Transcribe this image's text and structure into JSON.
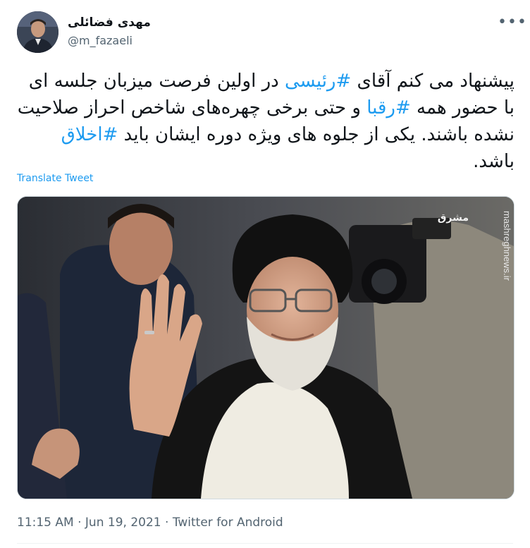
{
  "author": {
    "display_name": "مهدی فضائلی",
    "handle": "@m_fazaeli"
  },
  "more_icon": "more-horizontal-icon",
  "tweet": {
    "segments": [
      {
        "text": "پیشنهاد می کنم آقای ",
        "hashtag": false
      },
      {
        "text": "#رئیسی",
        "hashtag": true
      },
      {
        "text": " در اولین فرصت میزبان جلسه ای با حضور همه ",
        "hashtag": false
      },
      {
        "text": "#رقبا",
        "hashtag": true
      },
      {
        "text": " و حتی برخی چهره‌های شاخص احراز صلاحیت نشده باشند. یکی از جلوه های ویژه دوره ایشان باید ",
        "hashtag": false
      },
      {
        "text": "#اخلاق",
        "hashtag": true
      },
      {
        "text": " باشد.",
        "hashtag": false
      }
    ],
    "translate_label": "Translate Tweet"
  },
  "photo": {
    "watermark": "mashreghnews.ir",
    "logo_text": "مشرق"
  },
  "meta": {
    "time": "11:15 AM",
    "date": "Jun 19, 2021",
    "source": "Twitter for Android",
    "separator": "·"
  },
  "colors": {
    "link": "#1d9bf0",
    "text": "#0f1419",
    "secondary": "#536471"
  }
}
